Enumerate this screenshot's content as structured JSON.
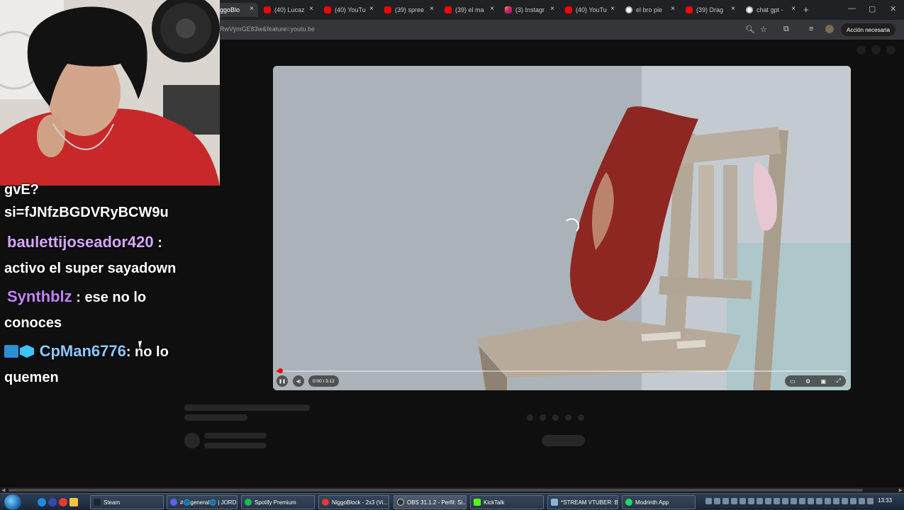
{
  "browser": {
    "tabs": [
      {
        "label": "ggoBlo",
        "icon": "none",
        "active": true
      },
      {
        "label": "(40) Lucaz",
        "icon": "youtube-icon"
      },
      {
        "label": "(40) YouTu",
        "icon": "youtube-icon"
      },
      {
        "label": "(39) spree",
        "icon": "youtube-icon"
      },
      {
        "label": "(39) el ma",
        "icon": "youtube-icon"
      },
      {
        "label": "(3) Instagr",
        "icon": "instagram-icon"
      },
      {
        "label": "(40) YouTu",
        "icon": "youtube-icon"
      },
      {
        "label": "el bro pie",
        "icon": "globe-icon"
      },
      {
        "label": "(39) Drag",
        "icon": "youtube-icon"
      },
      {
        "label": "chat gpt -",
        "icon": "globe-icon"
      }
    ],
    "close_glyph": "×",
    "new_tab_glyph": "+",
    "url": "RwVymGE83w&feature=youtu.be",
    "action_button": "Acción necesaria"
  },
  "player": {
    "time": "0:00 / 3:12",
    "progress": 0.005,
    "pause_glyph": "❚❚",
    "volume_glyph": "◀)",
    "fullscreen_glyph": "⤢"
  },
  "chat": {
    "messages": [
      {
        "text": "gvE?"
      },
      {
        "text": "si=fJNfzBGDVRyBCW9u"
      },
      {
        "user": "baulettijoseador420",
        "sep": " :",
        "text": "activo el super sayadown"
      },
      {
        "user": "Synthblz",
        "sep": " : ese no lo",
        "text": "conoces"
      },
      {
        "user": "CpMan6776",
        "sep": ": no lo",
        "text": "quemen"
      }
    ]
  },
  "taskbar": {
    "items": [
      {
        "label": "Steam"
      },
      {
        "label": "#🌐general🌐 | JORD..."
      },
      {
        "label": "Spotify Premium"
      },
      {
        "label": "NiggoBlock - 2x3 (Vi..."
      },
      {
        "label": "OBS 31.1.2 - Perfil: Si..."
      },
      {
        "label": "KickTalk"
      },
      {
        "label": "*STREAM VTUBER: Bl..."
      },
      {
        "label": "Modrinth App"
      }
    ],
    "clock": "13:33"
  },
  "colors": {
    "accent_red": "#ff0000",
    "chat_user_1": "#d6a8ff",
    "chat_user_2": "#c084fc",
    "chat_user_3": "#8fc7ff"
  }
}
